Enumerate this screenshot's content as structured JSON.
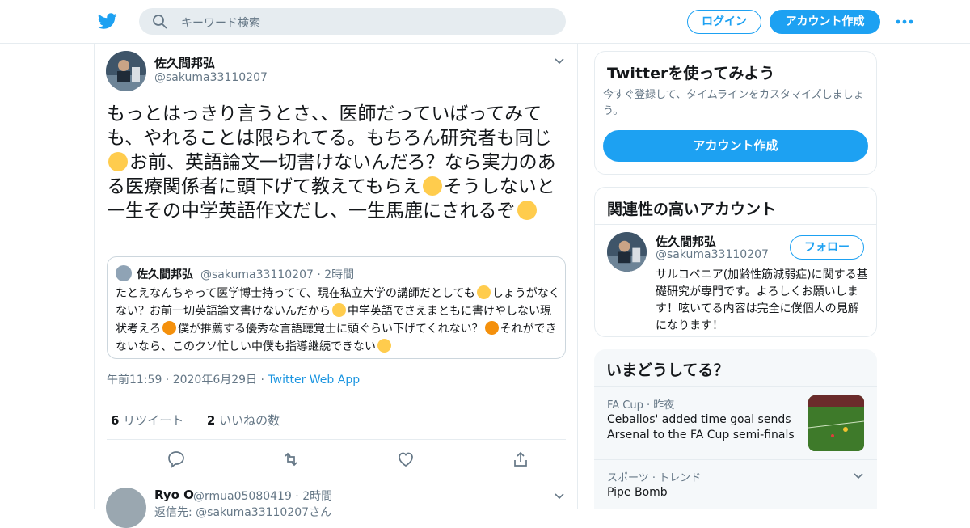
{
  "header": {
    "search_placeholder": "キーワード検索",
    "login_label": "ログイン",
    "signup_label": "アカウント作成"
  },
  "tweet": {
    "author_name": "佐久間邦弘",
    "author_handle": "@sakuma33110207",
    "text_parts": [
      "もっとはっきり言うとさ、、医師だっていばってみても、やれることは限られてる。もちろん研究者も同じ",
      "お前、英語論文一切書けないんだろ？なら実力のある医療関係者に頭下げて教えてもらえ",
      "そうしないと一生その中学英語作文だし、一生馬鹿にされるぞ"
    ],
    "timestamp": "午前11:59 · 2020年6月29日",
    "client": "Twitter Web App",
    "retweet_count": "6",
    "retweet_label": "リツイート",
    "like_count": "2",
    "like_label": "いいねの数"
  },
  "quoted": {
    "author_name": "佐久間邦弘",
    "author_handle": "@sakuma33110207",
    "age": "2時間",
    "text_parts": [
      "たとえなんちゃって医学博士持ってて、現在私立大学の講師だとしても",
      "しょうがなくない？お前一切英語論文書けないんだから",
      "中学英語でさえまともに書けやしない現状考えろ",
      "僕が推薦する優秀な言語聴覚士に頭ぐらい下げてくれない？",
      "それができないなら、このクソ忙しい中僕も指導継続できない"
    ]
  },
  "reply": {
    "author_name": "Ryo O",
    "author_handle": "@rmua05080419",
    "age": "2時間",
    "sub": "返信先: @sakuma33110207さん"
  },
  "signup_card": {
    "title": "Twitterを使ってみよう",
    "subtitle": "今すぐ登録して、タイムラインをカスタマイズしましょう。",
    "button_label": "アカウント作成"
  },
  "related_card": {
    "title": "関連性の高いアカウント",
    "name": "佐久間邦弘",
    "handle": "@sakuma33110207",
    "follow_label": "フォロー",
    "bio": "サルコペニア(加齢性筋減弱症)に関する基礎研究が専門です。よろしくお願いします！呟いてる内容は完全に僕個人の見解になります！"
  },
  "trends_card": {
    "title": "いまどうしてる？",
    "items": [
      {
        "meta": "FA Cup · 昨夜",
        "title": "Ceballos' added time goal sends Arsenal to the FA Cup semi-finals"
      },
      {
        "meta": "スポーツ · トレンド",
        "title": "Pipe Bomb"
      }
    ]
  },
  "colors": {
    "brand": "#1da1f2",
    "muted": "#657786",
    "border": "#e6ecf0"
  }
}
